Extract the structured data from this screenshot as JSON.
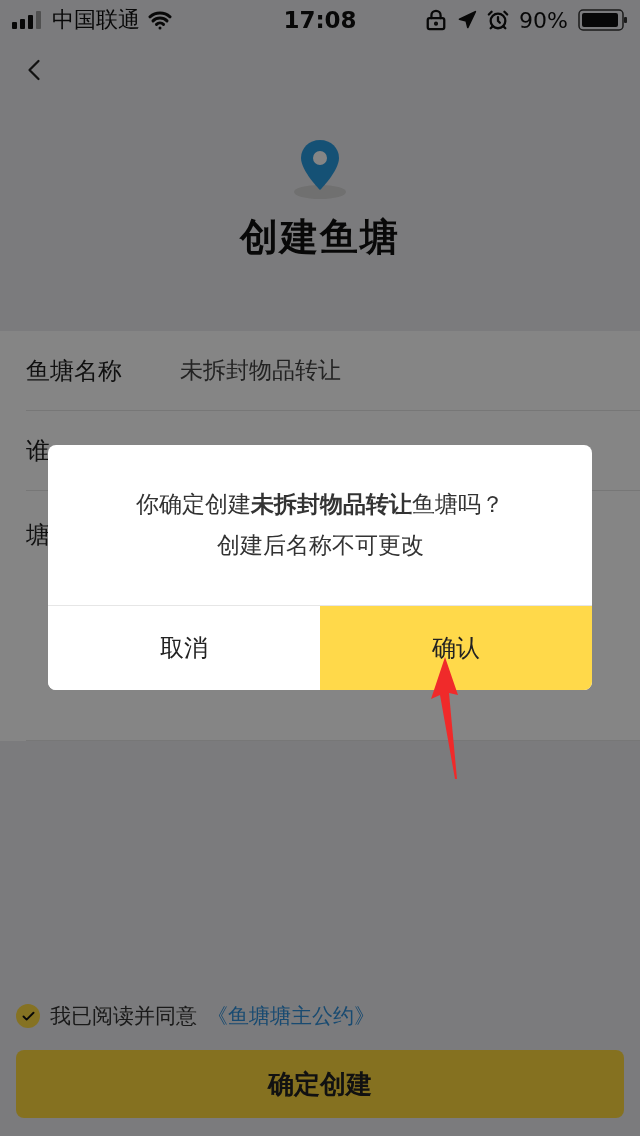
{
  "status_bar": {
    "carrier": "中国联通",
    "time": "17:08",
    "battery": "90%"
  },
  "header": {
    "title": "创建鱼塘"
  },
  "form": {
    "rows": [
      {
        "label": "鱼塘名称",
        "value": "未拆封物品转让"
      },
      {
        "label": "谁"
      },
      {
        "label": "塘"
      }
    ]
  },
  "agreement": {
    "checked": true,
    "text": "我已阅读并同意",
    "link": "《鱼塘塘主公约》"
  },
  "submit_button": "确定创建",
  "dialog": {
    "message": "你确定创建**未拆封物品转让**鱼塘吗？",
    "note": "创建后名称不可更改",
    "buttons": [
      {
        "label": "取消",
        "kind": "cancel"
      },
      {
        "label": "确认",
        "kind": "confirm"
      }
    ]
  }
}
